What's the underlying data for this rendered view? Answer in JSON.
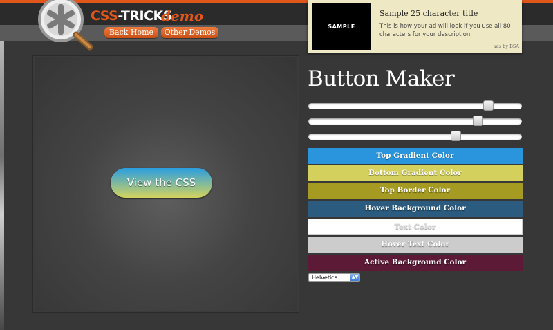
{
  "header": {
    "logo_text_main": "CSS",
    "logo_text_dash": "-TRICKS",
    "logo_text_demo": "demo",
    "nav": [
      {
        "label": "Back Home"
      },
      {
        "label": "Other Demos"
      }
    ]
  },
  "ad": {
    "image_text": "SAMPLE",
    "title": "Sample 25 character title",
    "description": "This is how your ad will look if you use all 80 characters for your description.",
    "byline": "ads by BSA"
  },
  "preview": {
    "button_label": "View the CSS"
  },
  "panel": {
    "title": "Button Maker",
    "sliders": [
      0.86,
      0.81,
      0.7
    ],
    "swatches": [
      {
        "label": "Top Gradient Color",
        "color": "#2a94dc"
      },
      {
        "label": "Bottom Gradient Color",
        "color": "#d4d05e"
      },
      {
        "label": "Top Border Color",
        "color": "#a59b22"
      },
      {
        "label": "Hover Background Color",
        "color": "#2b5c80"
      },
      {
        "label": "Text Color",
        "color": "#ffffff"
      },
      {
        "label": "Hover Text Color",
        "color": "#cccccc"
      },
      {
        "label": "Active Background Color",
        "color": "#5c1a37"
      }
    ],
    "font_select": "Helvetica"
  },
  "colors": {
    "accent": "#e0561b",
    "background": "#373737"
  }
}
